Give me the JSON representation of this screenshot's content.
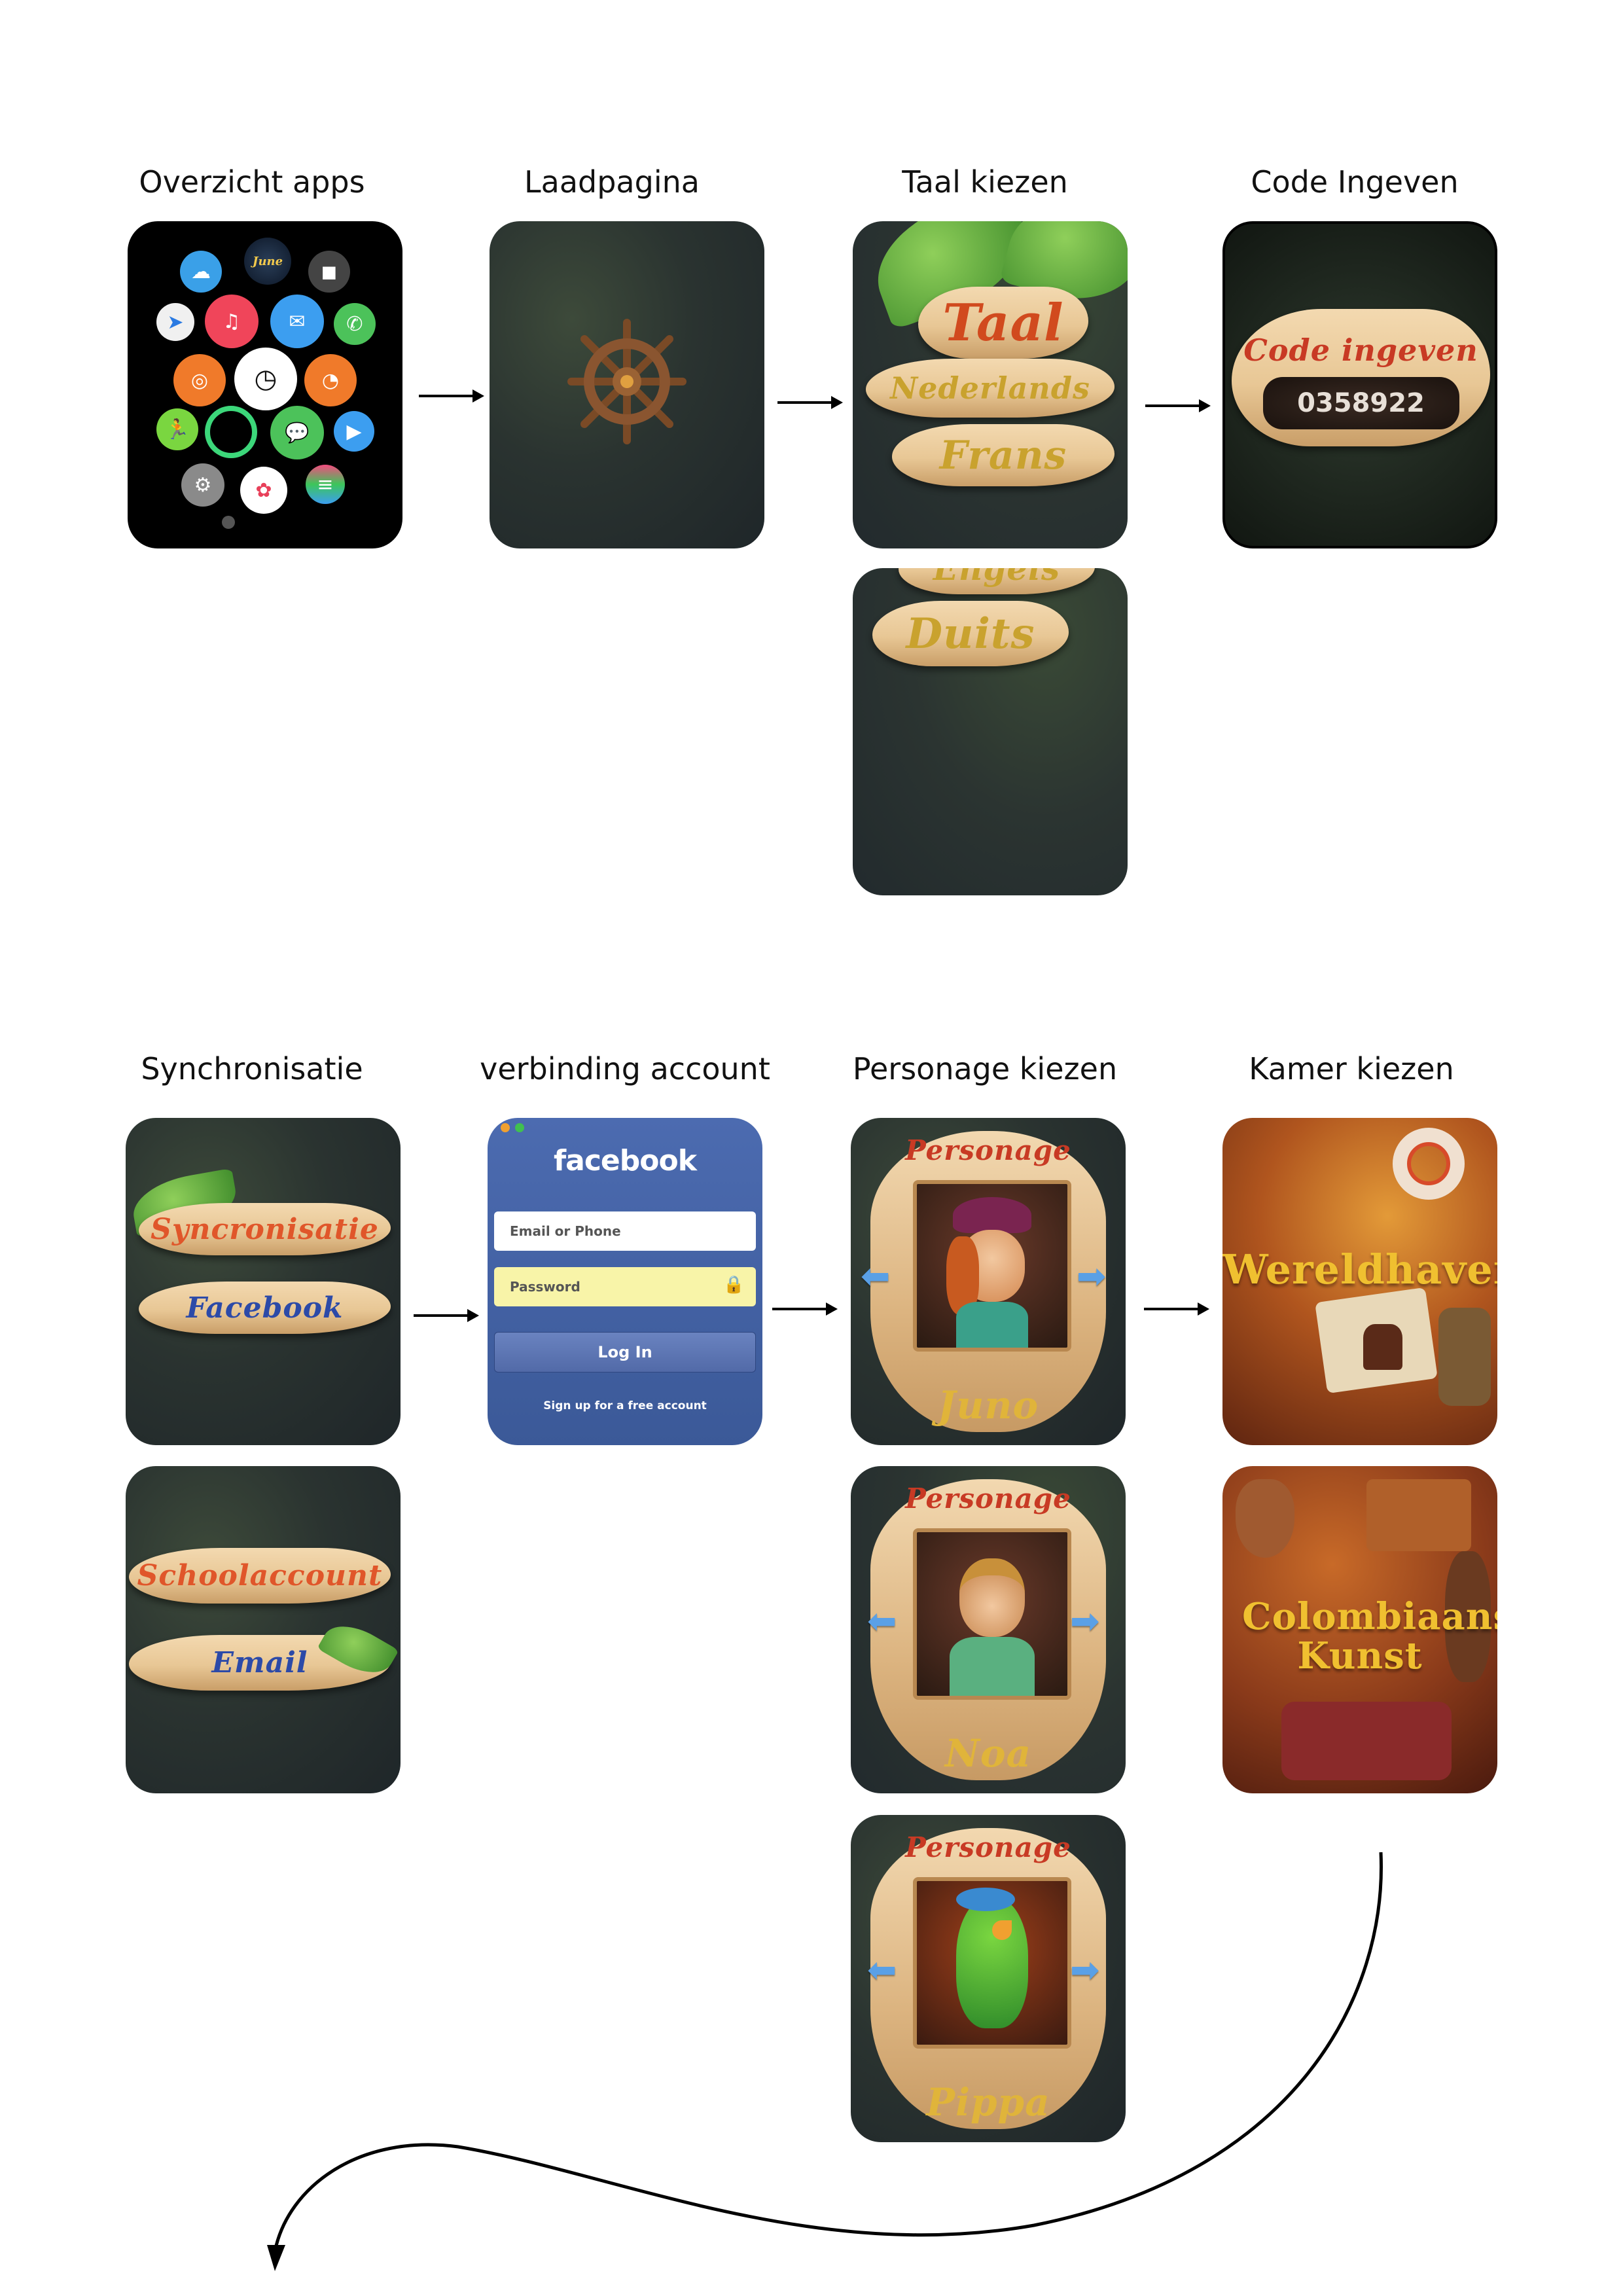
{
  "row1": {
    "titles": [
      "Overzicht apps",
      "Laadpagina",
      "Taal kiezen",
      "Code Ingeven"
    ]
  },
  "apps": {
    "june_label": "June"
  },
  "taal": {
    "heading": "Taal",
    "languages": [
      "Nederlands",
      "Frans",
      "Engels",
      "Duits"
    ]
  },
  "code": {
    "heading": "Code ingeven",
    "value": "0358922"
  },
  "row2": {
    "titles": [
      "Synchronisatie",
      "verbinding account",
      "Personage kiezen",
      "Kamer kiezen"
    ]
  },
  "sync": {
    "screen1": [
      "Syncronisatie",
      "Facebook"
    ],
    "screen2": [
      "Schoolaccount",
      "Email"
    ]
  },
  "facebook": {
    "logo": "facebook",
    "email_placeholder": "Email or Phone",
    "password_placeholder": "Password",
    "login_label": "Log In",
    "signup_label": "Sign up for a free account"
  },
  "personage": {
    "heading": "Personage",
    "characters": [
      "Juno",
      "Noa",
      "Pippa"
    ]
  },
  "kamer": {
    "rooms": [
      "Wereldhaven",
      "Colombiaanse Kunst"
    ]
  },
  "colors": {
    "accent_orange": "#e0562a",
    "plank_text_blue": "#2c4aa8",
    "title_gold": "#e0b43a",
    "facebook_blue": "#3b5998"
  }
}
